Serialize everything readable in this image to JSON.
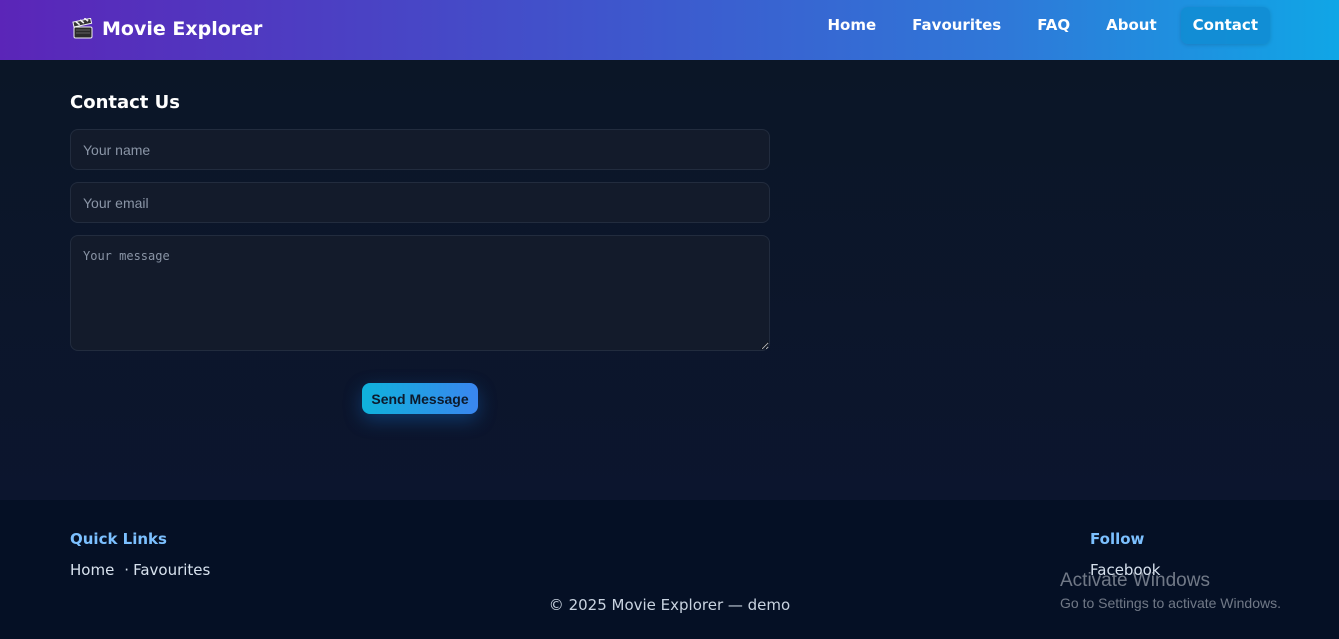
{
  "header": {
    "brand_title": "Movie Explorer",
    "brand_icon": "clapperboard-icon",
    "nav": [
      {
        "label": "Home",
        "active": false
      },
      {
        "label": "Favourites",
        "active": false
      },
      {
        "label": "FAQ",
        "active": false
      },
      {
        "label": "About",
        "active": false
      },
      {
        "label": "Contact",
        "active": true
      }
    ]
  },
  "contact": {
    "title": "Contact Us",
    "name_placeholder": "Your name",
    "email_placeholder": "Your email",
    "message_placeholder": "Your message",
    "name_value": "",
    "email_value": "",
    "message_value": "",
    "send_label": "Send Message"
  },
  "footer": {
    "quick_links_title": "Quick Links",
    "quick_links": [
      "Home",
      "Favourites"
    ],
    "quick_links_separator": "·",
    "follow_title": "Follow",
    "follow_links": [
      "Facebook"
    ],
    "copyright": "© 2025 Movie Explorer — demo"
  },
  "system_overlay": {
    "title": "Activate Windows",
    "subtitle": "Go to Settings to activate Windows."
  },
  "colors": {
    "header_gradient_start": "#5b25b8",
    "header_gradient_end": "#10a6e6",
    "background": "#0b1626",
    "footer_background": "#051025",
    "footer_heading": "#7cc0ff",
    "button_gradient_start": "#0fb2db",
    "button_gradient_end": "#3a86ef"
  }
}
